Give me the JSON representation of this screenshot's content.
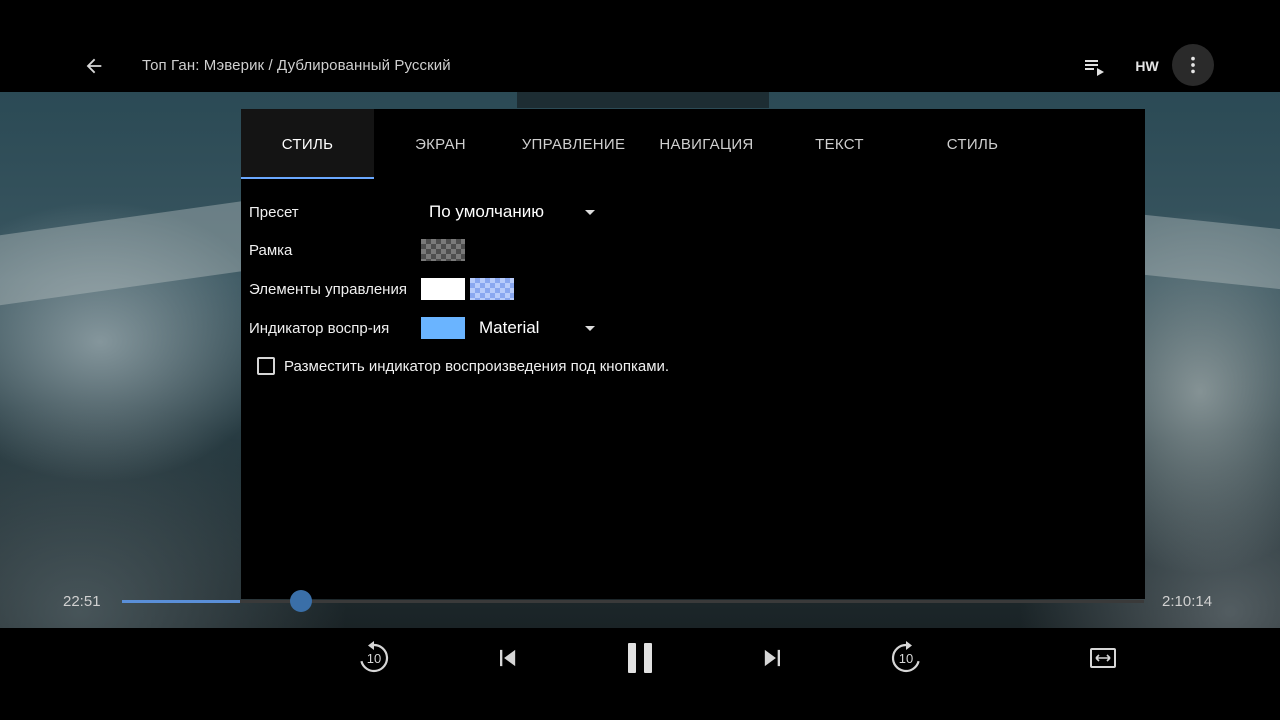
{
  "header": {
    "title": "Топ Ган: Мэверик / Дублированный Русский",
    "hw_label": "HW"
  },
  "icons": {
    "back": "arrow-left-icon",
    "playlist": "playlist-play-icon",
    "more": "more-vertical-icon",
    "rewind": "replay-10-icon",
    "previous": "skip-previous-icon",
    "pause": "pause-icon",
    "next": "skip-next-icon",
    "forward": "forward-10-icon",
    "aspect": "aspect-ratio-icon"
  },
  "panel": {
    "tabs": [
      {
        "label": "СТИЛЬ",
        "active": true
      },
      {
        "label": "ЭКРАН",
        "active": false
      },
      {
        "label": "УПРАВЛЕНИЕ",
        "active": false
      },
      {
        "label": "НАВИГАЦИЯ",
        "active": false
      },
      {
        "label": "ТЕКСТ",
        "active": false
      },
      {
        "label": "СТИЛЬ",
        "active": false
      }
    ],
    "preset": {
      "label": "Пресет",
      "value": "По умолчанию"
    },
    "frame": {
      "label": "Рамка",
      "color": "checker-dark"
    },
    "controls": {
      "label": "Элементы управления",
      "colors": [
        "#ffffff",
        "checker-blue"
      ]
    },
    "indicator": {
      "label": "Индикатор воспр-ия",
      "color": "#6ab4ff",
      "value": "Material"
    },
    "checkbox": {
      "label": "Разместить индикатор воспроизведения под кнопками.",
      "checked": false
    }
  },
  "player": {
    "current_time": "22:51",
    "duration": "2:10:14",
    "progress": 0.175,
    "buffered": 0.115,
    "rewind_seconds": "10",
    "forward_seconds": "10",
    "accent_color": "#5a8fd8"
  }
}
